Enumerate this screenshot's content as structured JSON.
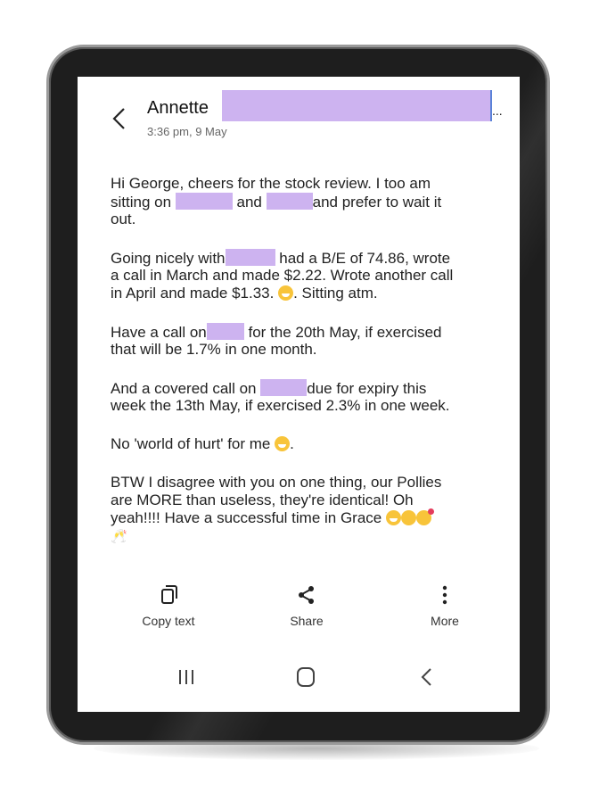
{
  "conversation": {
    "contact_name": "Annette",
    "contact_overflow": "...",
    "timestamp": "3:36 pm, 9 May"
  },
  "message": {
    "p1_l1": "Hi George, cheers for the stock review.  I too am",
    "p1_l2a": "sitting on",
    "p1_l2b": "and",
    "p1_l2c": "and prefer to wait it",
    "p1_l3": "out.",
    "p2_l1a": "Going nicely with",
    "p2_l1b": "had a B/E of 74.86, wrote",
    "p2_l2": "a call in March and made $2.22. Wrote another call",
    "p2_l3a": "in April and made $1.33.",
    "p2_l3b": ". Sitting atm.",
    "p3_l1a": "Have a call on",
    "p3_l1b": "for the 20th May, if exercised",
    "p3_l2": "that will be 1.7% in one month.",
    "p4_l1a": "And a covered call on",
    "p4_l1b": "due for expiry this",
    "p4_l2": "week the  13th May, if exercised 2.3% in one week.",
    "p5_l1": "No 'world of hurt' for me",
    "p5_l1b": ".",
    "p6_l1": "BTW I disagree with you on one thing, our Pollies",
    "p6_l2": "are MORE than useless, they're identical!  Oh",
    "p6_l3": "yeah!!!!  Have a successful time in Grace"
  },
  "actions": {
    "copy_label": "Copy text",
    "share_label": "Share",
    "more_label": "More"
  },
  "icons": [
    "back-icon",
    "copy-icon",
    "share-icon",
    "more-icon",
    "recents-icon",
    "home-icon",
    "nav-back-icon"
  ],
  "colors": {
    "redaction": "#cdb3f0",
    "bezel": "#1e1e1e"
  }
}
